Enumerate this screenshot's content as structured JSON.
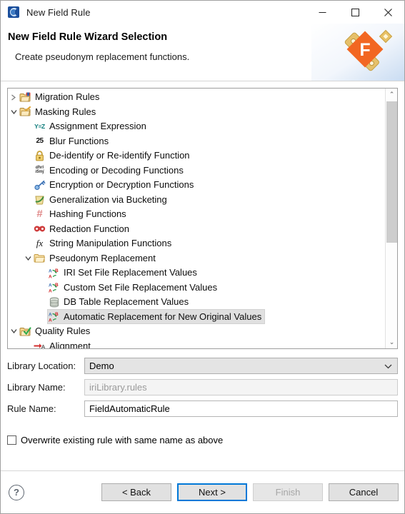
{
  "window": {
    "title": "New Field Rule",
    "app_icon": "app-swirl-icon",
    "minimize_glyph": "—",
    "maximize_glyph": "☐",
    "close_glyph": "✕"
  },
  "header": {
    "title": "New Field Rule Wizard Selection",
    "subtitle": "Create pseudonym replacement functions.",
    "brand_letter": "F",
    "brand_color": "#f26722"
  },
  "tree": {
    "scroll": {
      "up_glyph": "⌃",
      "down_glyph": "⌄"
    },
    "items": [
      {
        "label": "Migration Rules",
        "indent": 0,
        "twisty": "collapsed",
        "icon": "folder-migration-icon",
        "selected": false
      },
      {
        "label": "Masking Rules",
        "indent": 0,
        "twisty": "expanded",
        "icon": "folder-masking-icon",
        "selected": false
      },
      {
        "label": "Assignment Expression",
        "indent": 1,
        "twisty": "none",
        "icon": "assignment-expression-icon",
        "selected": false
      },
      {
        "label": "Blur Functions",
        "indent": 1,
        "twisty": "none",
        "icon": "blur-functions-icon",
        "selected": false
      },
      {
        "label": "De-identify or Re-identify Function",
        "indent": 1,
        "twisty": "none",
        "icon": "lock-icon",
        "selected": false
      },
      {
        "label": "Encoding or Decoding Functions",
        "indent": 1,
        "twisty": "none",
        "icon": "encoding-decoding-icon",
        "selected": false
      },
      {
        "label": "Encryption or Decryption Functions",
        "indent": 1,
        "twisty": "none",
        "icon": "key-icon",
        "selected": false
      },
      {
        "label": "Generalization via Bucketing",
        "indent": 1,
        "twisty": "none",
        "icon": "bucket-icon",
        "selected": false
      },
      {
        "label": "Hashing Functions",
        "indent": 1,
        "twisty": "none",
        "icon": "hash-icon",
        "selected": false
      },
      {
        "label": "Redaction Function",
        "indent": 1,
        "twisty": "none",
        "icon": "redaction-mask-icon",
        "selected": false
      },
      {
        "label": "String Manipulation Functions",
        "indent": 1,
        "twisty": "none",
        "icon": "function-fx-icon",
        "selected": false
      },
      {
        "label": "Pseudonym Replacement",
        "indent": 1,
        "twisty": "expanded",
        "icon": "folder-open-icon",
        "selected": false
      },
      {
        "label": "IRI Set File Replacement Values",
        "indent": 2,
        "twisty": "none",
        "icon": "replacement-ab-icon",
        "selected": false
      },
      {
        "label": "Custom Set File Replacement Values",
        "indent": 2,
        "twisty": "none",
        "icon": "replacement-ab-icon",
        "selected": false
      },
      {
        "label": "DB Table Replacement Values",
        "indent": 2,
        "twisty": "none",
        "icon": "database-icon",
        "selected": false
      },
      {
        "label": "Automatic Replacement for New Original Values",
        "indent": 2,
        "twisty": "none",
        "icon": "replacement-ab-icon",
        "selected": true
      },
      {
        "label": "Quality Rules",
        "indent": 0,
        "twisty": "expanded",
        "icon": "folder-quality-icon",
        "selected": false
      },
      {
        "label": "Alignment",
        "indent": 1,
        "twisty": "none",
        "icon": "alignment-arrow-icon",
        "selected": false
      }
    ]
  },
  "form": {
    "library_location_label": "Library Location:",
    "library_location_value": "Demo",
    "library_name_label": "Library Name:",
    "library_name_value": "iriLibrary.rules",
    "rule_name_label": "Rule Name:",
    "rule_name_value": "FieldAutomaticRule",
    "overwrite_label": "Overwrite existing rule with same name as above",
    "overwrite_checked": false
  },
  "footer": {
    "help_glyph": "?",
    "back_label": "< Back",
    "next_label": "Next >",
    "finish_label": "Finish",
    "cancel_label": "Cancel"
  }
}
